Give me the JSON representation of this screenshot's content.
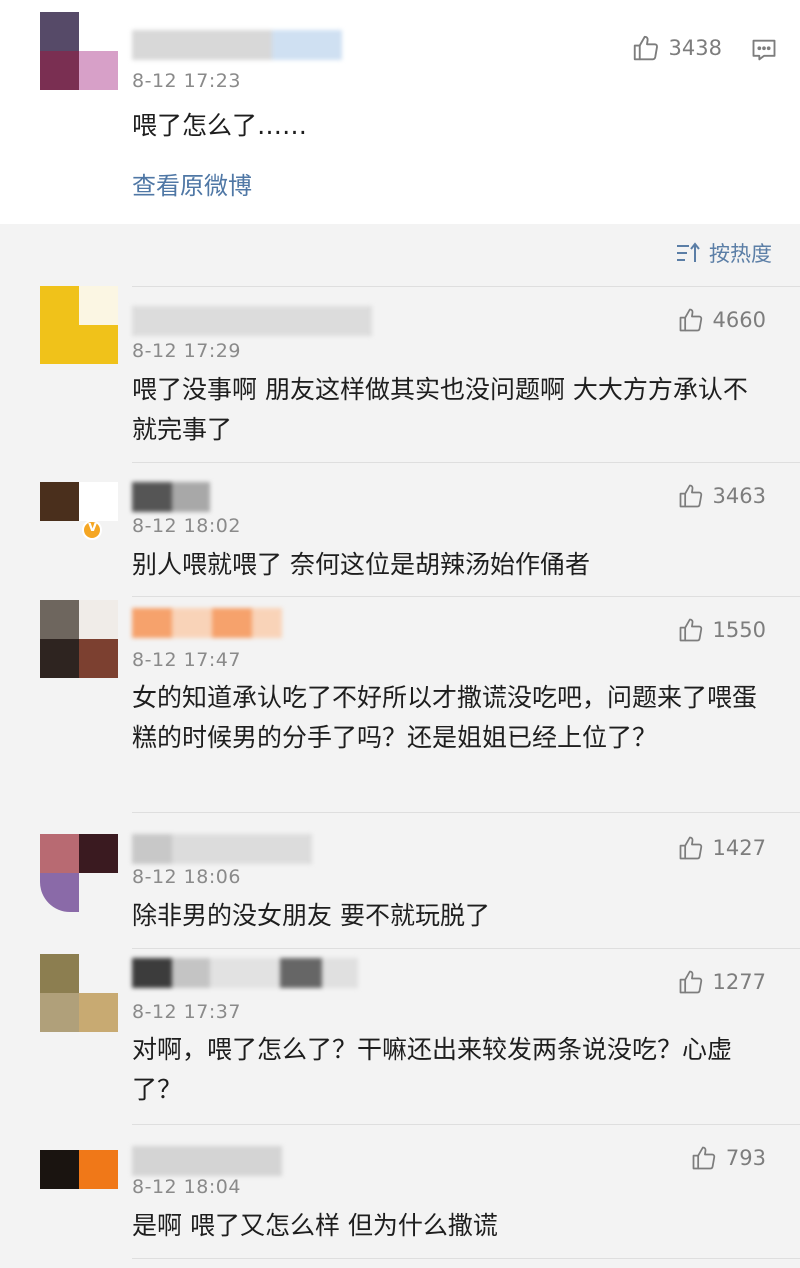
{
  "top_comment": {
    "time": "8-12 17:23",
    "likes": "3438",
    "text": "喂了怎么了……",
    "link_label": "查看原微博"
  },
  "sort": {
    "label": "按热度",
    "icon": "sort-icon"
  },
  "comments": [
    {
      "time": "8-12 17:29",
      "likes": "4660",
      "text": "喂了没事啊 朋友这样做其实也没问题啊 大大方方承认不就完事了"
    },
    {
      "time": "8-12 18:02",
      "likes": "3463",
      "text": "别人喂就喂了 奈何这位是胡辣汤始作俑者"
    },
    {
      "time": "8-12 17:47",
      "likes": "1550",
      "text": "女的知道承认吃了不好所以才撒谎没吃吧，问题来了喂蛋糕的时候男的分手了吗？还是姐姐已经上位了？"
    },
    {
      "time": "8-12 18:06",
      "likes": "1427",
      "text": "除非男的没女朋友 要不就玩脱了"
    },
    {
      "time": "8-12 17:37",
      "likes": "1277",
      "text": "对啊，喂了怎么了？干嘛还出来较发两条说没吃？心虚了？"
    },
    {
      "time": "8-12 18:04",
      "likes": "793",
      "text": "是啊 喂了又怎么样 但为什么撒谎"
    }
  ],
  "icons": {
    "like": "thumbs-up-icon",
    "reply": "comment-icon",
    "verified": "verified-badge-icon"
  },
  "colors": {
    "link": "#4f77a5",
    "muted": "#8a8a8a",
    "background": "#f3f3f3",
    "card": "#ffffff"
  }
}
